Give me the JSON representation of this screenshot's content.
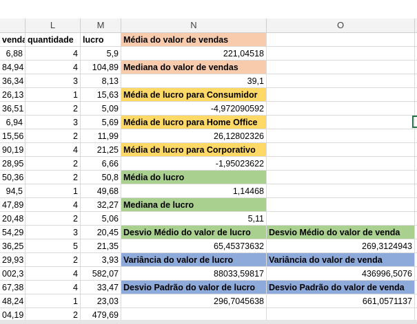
{
  "columns": {
    "L": "L",
    "M": "M",
    "N": "N",
    "O": "O"
  },
  "rows": [
    {
      "k": "venda",
      "l": "quantidade",
      "m": "lucro",
      "n": "Média do valor de vendas",
      "n_style": "peach",
      "o": "",
      "o_style": ""
    },
    {
      "k": "6,88",
      "l": "4",
      "m": "5,9",
      "n": "221,04518",
      "n_style": "num",
      "o": "",
      "o_style": ""
    },
    {
      "k": "84,94",
      "l": "4",
      "m": "104,89",
      "n": "Mediana do valor de vendas",
      "n_style": "peach",
      "o": "",
      "o_style": ""
    },
    {
      "k": "36,34",
      "l": "3",
      "m": "8,13",
      "n": "39,1",
      "n_style": "num",
      "o": "",
      "o_style": ""
    },
    {
      "k": "26,13",
      "l": "1",
      "m": "15,63",
      "n": "Média de lucro para Consumidor",
      "n_style": "yellow",
      "o": "",
      "o_style": ""
    },
    {
      "k": "36,51",
      "l": "2",
      "m": "5,09",
      "n": "-4,972090592",
      "n_style": "num",
      "o": "",
      "o_style": ""
    },
    {
      "k": "6,94",
      "l": "3",
      "m": "5,69",
      "n": "Média de lucro para Home Office",
      "n_style": "yellow",
      "o": "",
      "o_style": ""
    },
    {
      "k": "15,56",
      "l": "2",
      "m": "11,99",
      "n": "26,12802326",
      "n_style": "num",
      "o": "",
      "o_style": ""
    },
    {
      "k": "90,19",
      "l": "4",
      "m": "21,25",
      "n": "Média de lucro para Corporativo",
      "n_style": "yellow",
      "o": "",
      "o_style": ""
    },
    {
      "k": "28,95",
      "l": "2",
      "m": "6,66",
      "n": "-1,95023622",
      "n_style": "num",
      "o": "",
      "o_style": ""
    },
    {
      "k": "50,36",
      "l": "2",
      "m": "50,8",
      "n": "Média do lucro",
      "n_style": "green",
      "o": "",
      "o_style": ""
    },
    {
      "k": "94,5",
      "l": "1",
      "m": "49,68",
      "n": "1,14468",
      "n_style": "num",
      "o": "",
      "o_style": ""
    },
    {
      "k": "47,89",
      "l": "4",
      "m": "32,27",
      "n": "Mediana de lucro",
      "n_style": "green",
      "o": "",
      "o_style": ""
    },
    {
      "k": "20,48",
      "l": "2",
      "m": "5,06",
      "n": "5,11",
      "n_style": "num",
      "o": "",
      "o_style": ""
    },
    {
      "k": "54,29",
      "l": "3",
      "m": "20,45",
      "n": "Desvio Médio do valor de lucro",
      "n_style": "green",
      "o": "Desvio Médio do valor de venda",
      "o_style": "green"
    },
    {
      "k": "36,25",
      "l": "5",
      "m": "21,35",
      "n": "65,45373632",
      "n_style": "num",
      "o": "269,3124943",
      "o_style": "num"
    },
    {
      "k": "29,93",
      "l": "2",
      "m": "3,93",
      "n": "Variância do valor de lucro",
      "n_style": "blue",
      "o": "Variância do valor de venda",
      "o_style": "blue"
    },
    {
      "k": "002,3",
      "l": "4",
      "m": "582,07",
      "n": "88033,59817",
      "n_style": "num",
      "o": "436996,5076",
      "o_style": "num"
    },
    {
      "k": "67,38",
      "l": "4",
      "m": "33,47",
      "n": "Desvio Padrão do valor de lucro",
      "n_style": "blue",
      "o": "Desvio Padrão do valor de venda",
      "o_style": "blue"
    },
    {
      "k": "48,24",
      "l": "1",
      "m": "23,03",
      "n": "296,7045638",
      "n_style": "num",
      "o": "661,0571137",
      "o_style": "num"
    },
    {
      "k": "04,19",
      "l": "2",
      "m": "479,69",
      "n": "",
      "n_style": "",
      "o": "",
      "o_style": ""
    }
  ],
  "colors": {
    "peach": "#f8cbad",
    "yellow": "#ffd966",
    "green": "#a9d08e",
    "blue": "#8eaadb"
  }
}
